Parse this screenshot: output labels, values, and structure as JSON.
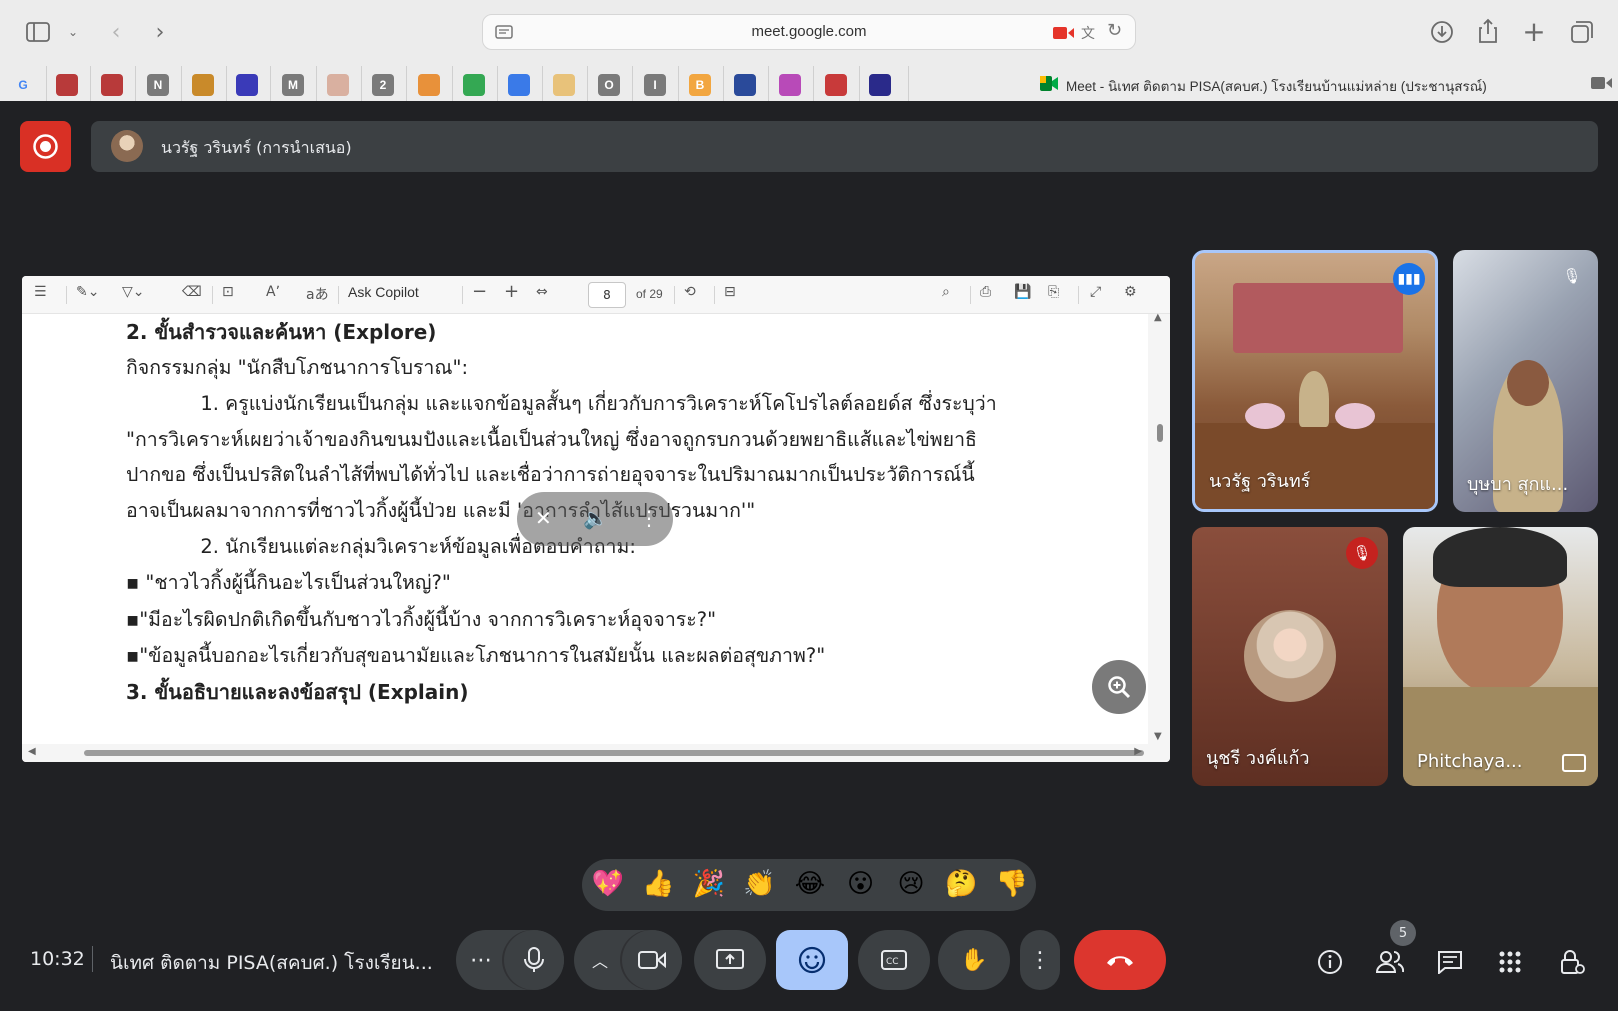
{
  "browser": {
    "url": "meet.google.com",
    "tab_title": "Meet - นิเทศ ติดตาม PISA(สคบศ.) โรงเรียนบ้านแม่หล่าย (ประชานุสรณ์)",
    "bookmarks": [
      {
        "icon": "google-icon",
        "label": "G",
        "color": "#ffffff"
      },
      {
        "icon": "red-bird-icon",
        "label": "",
        "color": "#b83a3a"
      },
      {
        "icon": "red-bird-icon",
        "label": "",
        "color": "#b83a3a"
      },
      {
        "icon": "n-icon",
        "label": "N",
        "color": "#7a7a7a"
      },
      {
        "icon": "flask-icon",
        "label": "",
        "color": "#c98a2a"
      },
      {
        "icon": "bird-logo-icon",
        "label": "",
        "color": "#3a3ab8"
      },
      {
        "icon": "m-icon",
        "label": "M",
        "color": "#7a7a7a"
      },
      {
        "icon": "seal-icon",
        "label": "",
        "color": "#d9b0a0"
      },
      {
        "icon": "two-icon",
        "label": "2",
        "color": "#7a7a7a"
      },
      {
        "icon": "orange-circle-icon",
        "label": "",
        "color": "#e8913a"
      },
      {
        "icon": "maps-pin-icon",
        "label": "",
        "color": "#34a853"
      },
      {
        "icon": "c-circle-icon",
        "label": "",
        "color": "#3a7ae8"
      },
      {
        "icon": "bottle-icon",
        "label": "",
        "color": "#e8c27a"
      },
      {
        "icon": "o-icon",
        "label": "O",
        "color": "#7a7a7a"
      },
      {
        "icon": "i-icon",
        "label": "I",
        "color": "#7a7a7a"
      },
      {
        "icon": "b-icon",
        "label": "B",
        "color": "#f2a640"
      },
      {
        "icon": "layout-icon",
        "label": "",
        "color": "#2a4a9a"
      },
      {
        "icon": "k-icon",
        "label": "",
        "color": "#b84ab8"
      },
      {
        "icon": "pen-icon",
        "label": "",
        "color": "#c83a3a"
      },
      {
        "icon": "line-logo-icon",
        "label": "",
        "color": "#2a2a8a"
      }
    ]
  },
  "presenter": {
    "label": "นวรัฐ วรินทร์ (การนำเสนอ)"
  },
  "pdf": {
    "ask_copilot": "Ask Copilot",
    "page_number": "8",
    "page_total": "of 29",
    "lines": [
      {
        "text": "2. ขั้นสำรวจและค้นหา (Explore)",
        "heading": true
      },
      {
        "text": "กิจกรรมกลุ่ม \"นักสืบโภชนาการโบราณ\":"
      },
      {
        "text": "            1. ครูแบ่งนักเรียนเป็นกลุ่ม และแจกข้อมูลสั้นๆ เกี่ยวกับการวิเคราะห์โคโปรไลต์ลอยด์ส ซึ่งระบุว่า"
      },
      {
        "text": "\"การวิเคราะห์เผยว่าเจ้าของกินขนมปังและเนื้อเป็นส่วนใหญ่ ซึ่งอาจถูกรบกวนด้วยพยาธิแส้และไข่พยาธิ"
      },
      {
        "text": "ปากขอ ซึ่งเป็นปรสิตในลำไส้ที่พบได้ทั่วไป และเชื่อว่าการถ่ายอุจจาระในปริมาณมากเป็นประวัติการณ์นี้"
      },
      {
        "text": "อาจเป็นผลมาจากการที่ชาวไวกิ้งผู้นี้ป่วย และมี 'อาการลำไส้แปรปรวนมาก'\""
      },
      {
        "text": "            2. นักเรียนแต่ละกลุ่มวิเคราะห์ข้อมูลเพื่อตอบคำถาม:"
      },
      {
        "text": "▪ \"ชาวไวกิ้งผู้นี้กินอะไรเป็นส่วนใหญ่?\""
      },
      {
        "text": "▪\"มีอะไรผิดปกติเกิดขึ้นกับชาวไวกิ้งผู้นี้บ้าง จากการวิเคราะห์อุจจาระ?\""
      },
      {
        "text": "▪\"ข้อมูลนี้บอกอะไรเกี่ยวกับสุขอนามัยและโภชนาการในสมัยนั้น และผลต่อสุขภาพ?\""
      },
      {
        "text": "3. ขั้นอธิบายและลงข้อสรุป (Explain)",
        "heading": true
      }
    ]
  },
  "participants": [
    {
      "name": "นวรัฐ วรินทร์",
      "speaking": true
    },
    {
      "name": "บุษบา สุกแ...",
      "muted": true
    },
    {
      "name": "นุชรี วงค์แก้ว",
      "muted": true
    },
    {
      "name": "Phitchaya..."
    }
  ],
  "reactions": [
    "💖",
    "👍",
    "🎉",
    "👏",
    "😂",
    "😮",
    "😢",
    "🤔",
    "👎"
  ],
  "bottom": {
    "time": "10:32",
    "meeting_title": "นิเทศ ติดตาม PISA(สคบศ.) โรงเรียน...",
    "participant_count": "5"
  }
}
